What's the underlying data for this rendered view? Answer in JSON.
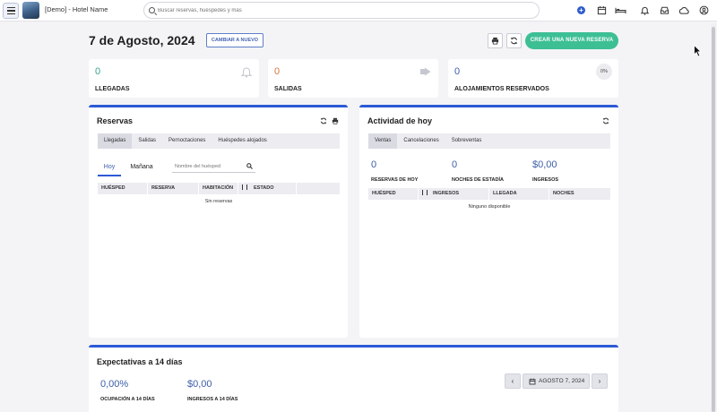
{
  "header": {
    "hotel_name": "[Demo] - Hotel Name",
    "search_placeholder": "Buscar reservas, huéspedes y más"
  },
  "date": {
    "title": "7 de  Agosto, 2024",
    "change_button": "CAMBIAR A NUEVO",
    "new_reservation_button": "CREAR UNA NUEVA RESERVA"
  },
  "stats": {
    "arrivals": {
      "value": "0",
      "label": "LLEGADAS"
    },
    "departures": {
      "value": "0",
      "label": "SALIDAS"
    },
    "booked": {
      "value": "0",
      "label": "ALOJAMIENTOS RESERVADOS",
      "percent": "0%"
    }
  },
  "reservas": {
    "title": "Reservas",
    "tabs": [
      "Llegadas",
      "Salidas",
      "Pernoctaciones",
      "Huéspedes alojados"
    ],
    "subtabs": [
      "Hoy",
      "Mañana"
    ],
    "guest_placeholder": "Nombre del huésped",
    "columns": [
      "HUÉSPED",
      "RESERVA",
      "HABITACIÓN",
      "ESTADO"
    ],
    "empty": "Sin reservas"
  },
  "actividad": {
    "title": "Actividad de hoy",
    "tabs": [
      "Ventas",
      "Cancelaciones",
      "Sobreventas"
    ],
    "metrics": [
      {
        "value": "0",
        "label": "RESERVAS DE HOY"
      },
      {
        "value": "0",
        "label": "NOCHES DE ESTADÍA"
      },
      {
        "value": "$0,00",
        "label": "INGRESOS"
      }
    ],
    "columns": [
      "HUÉSPED",
      "INGRESOS",
      "LLEGADA",
      "NOCHES"
    ],
    "empty": "Ninguno disponible"
  },
  "expectativas": {
    "title": "Expectativas a 14 días",
    "occupancy": {
      "value": "0,00%",
      "label": "OCUPACIÓN A 14 DÍAS"
    },
    "revenue": {
      "value": "$0,00",
      "label": "INGRESOS A 14 DÍAS"
    },
    "date_label": "AGOSTO 7, 2024"
  },
  "colors": {
    "accent_blue": "#2c5ad6",
    "green": "#3dbf94",
    "arrivals_teal": "#3aa38d",
    "departures_orange": "#d9733b"
  }
}
